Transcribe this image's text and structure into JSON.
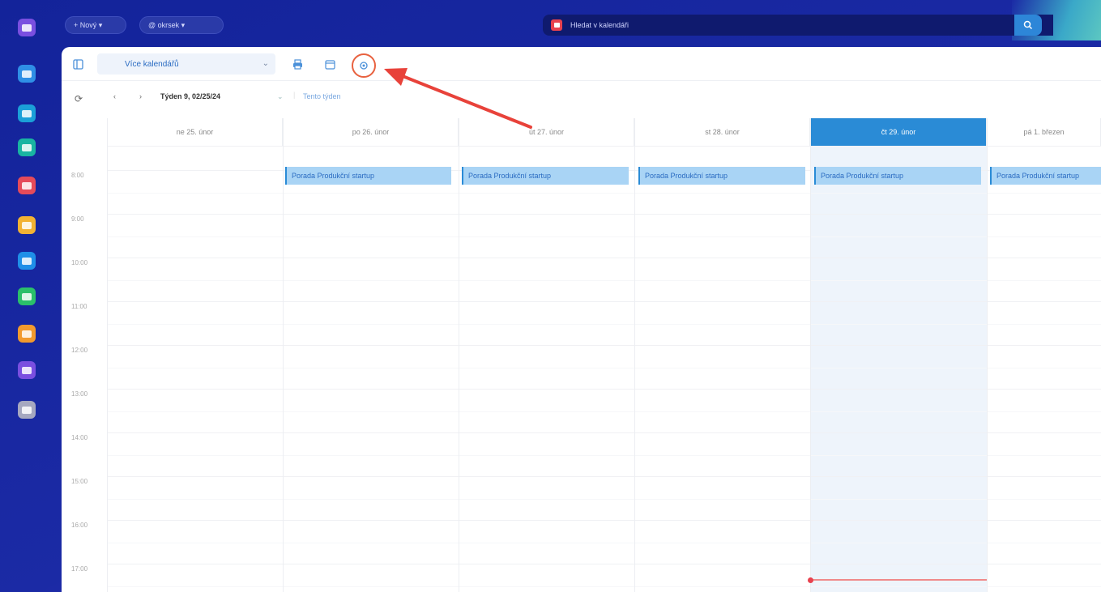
{
  "topbar": {
    "new_button": "+ Nový ▾",
    "account_button": "@ okrsek ▾",
    "search_placeholder": "Hledat v kalendáři",
    "search_icon": "search-icon"
  },
  "rail": {
    "apps": [
      {
        "name": "home",
        "color": "#7a4fe0"
      },
      {
        "name": "mail",
        "color": "#2f8fe6"
      },
      {
        "name": "chat",
        "color": "#1ba0d8"
      },
      {
        "name": "meet",
        "color": "#19b4a2"
      },
      {
        "name": "calendar",
        "color": "#e54b5a"
      },
      {
        "name": "notes",
        "color": "#f2b233"
      },
      {
        "name": "drive",
        "color": "#1f8fe8"
      },
      {
        "name": "tasks",
        "color": "#2bbf6a"
      },
      {
        "name": "files",
        "color": "#f29a2e"
      },
      {
        "name": "inbox",
        "color": "#7a4fe0"
      },
      {
        "name": "settings",
        "color": "#a6a8c0"
      }
    ]
  },
  "toolbar": {
    "calendar_select": "Více kalendářů",
    "week_label": "Týden 9, 02/25/24",
    "today_label": "Tento týden"
  },
  "days": [
    {
      "label": "ne 25. únor",
      "active": false
    },
    {
      "label": "po 26. únor",
      "active": false
    },
    {
      "label": "út 27. únor",
      "active": false
    },
    {
      "label": "st 28. únor",
      "active": false
    },
    {
      "label": "čt 29. únor",
      "active": true
    },
    {
      "label": "pá 1. březen",
      "active": false
    }
  ],
  "times": [
    "8:00",
    "9:00",
    "10:00",
    "11:00",
    "12:00",
    "13:00",
    "14:00",
    "15:00",
    "16:00",
    "17:00"
  ],
  "event_title": "Porada Produkční startup",
  "colors": {
    "accent": "#2a8bd6",
    "event_bg": "#a9d4f5",
    "annotation": "#e8423a"
  }
}
